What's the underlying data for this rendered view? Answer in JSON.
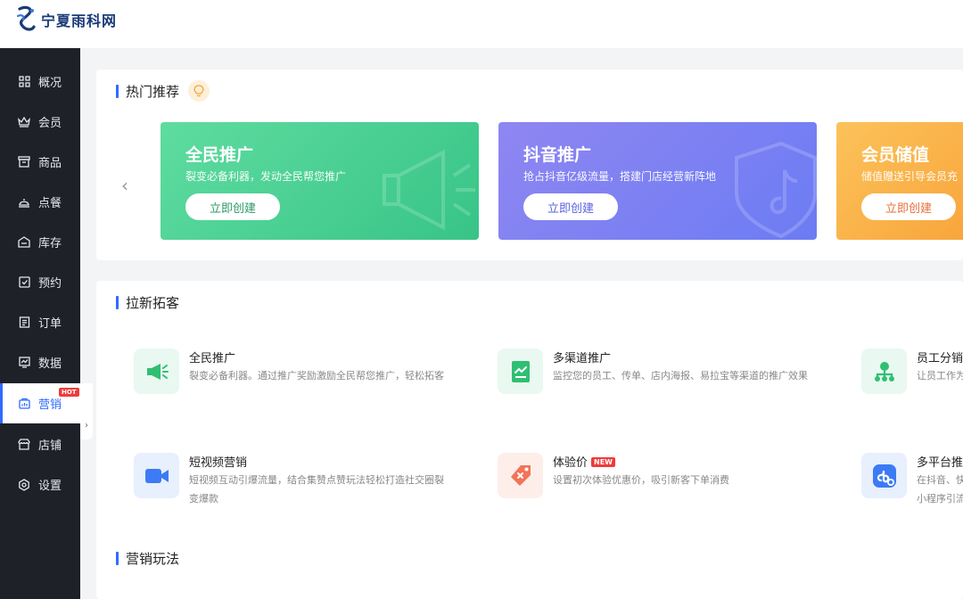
{
  "app": {
    "brand_name": "宁夏雨科网"
  },
  "sidebar": {
    "items": [
      {
        "label": "概况",
        "icon": "dashboard-icon"
      },
      {
        "label": "会员",
        "icon": "crown-icon"
      },
      {
        "label": "商品",
        "icon": "shop-icon"
      },
      {
        "label": "点餐",
        "icon": "dining-icon"
      },
      {
        "label": "库存",
        "icon": "inventory-icon"
      },
      {
        "label": "预约",
        "icon": "calendar-check-icon"
      },
      {
        "label": "订单",
        "icon": "order-icon"
      },
      {
        "label": "数据",
        "icon": "chart-icon"
      },
      {
        "label": "营销",
        "icon": "marketing-icon",
        "active": true,
        "badge": "HOT"
      },
      {
        "label": "店铺",
        "icon": "store-icon"
      },
      {
        "label": "设置",
        "icon": "settings-icon"
      }
    ]
  },
  "hot": {
    "title": "热门推荐",
    "cards": [
      {
        "title": "全民推广",
        "desc": "裂变必备利器，发动全民帮您推广",
        "button": "立即创建",
        "color": "#3dca8c"
      },
      {
        "title": "抖音推广",
        "desc": "抢占抖音亿级流量，搭建门店经营新阵地",
        "button": "立即创建",
        "color": "#7b82f4"
      },
      {
        "title": "会员储值",
        "desc": "储值赠送引导会员充",
        "button": "立即创建",
        "color": "#f9b040"
      }
    ]
  },
  "acquire": {
    "title": "拉新拓客",
    "items": [
      {
        "title": "全民推广",
        "desc": "裂变必备利器。通过推广奖励激励全民帮您推广，轻松拓客"
      },
      {
        "title": "多渠道推广",
        "desc": "监控您的员工、传单、店内海报、易拉宝等渠道的推广效果"
      },
      {
        "title": "员工分销",
        "desc": "让员工作为"
      },
      {
        "title": "短视频营销",
        "desc": "短视频互动引爆流量，结合集赞点赞玩法轻松打造社交圈裂变爆款"
      },
      {
        "title": "体验价",
        "badge": "NEW",
        "desc": "设置初次体验优惠价，吸引新客下单消费"
      },
      {
        "title": "多平台推",
        "desc": "在抖音、快\n小程序引流"
      }
    ]
  },
  "play": {
    "title": "营销玩法"
  }
}
